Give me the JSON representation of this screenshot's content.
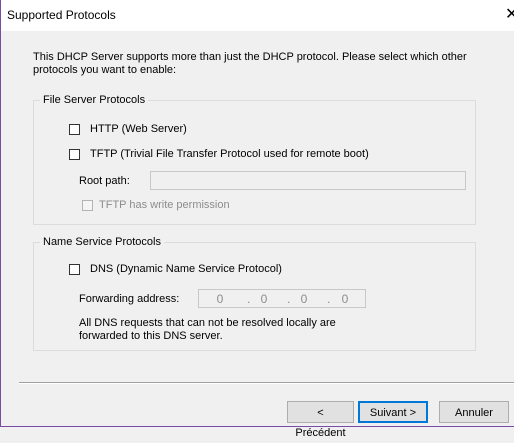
{
  "window": {
    "title": "Supported Protocols",
    "close_glyph": "✕"
  },
  "intro_text": "This DHCP Server supports more than just the DHCP protocol. Please select which other protocols you want to enable:",
  "file_server": {
    "group_label": "File Server Protocols",
    "http": {
      "label": "HTTP (Web Server)",
      "checked": false
    },
    "tftp": {
      "label": "TFTP (Trivial File Transfer Protocol used for remote boot)",
      "checked": false
    },
    "root_path_label": "Root path:",
    "root_path_value": "",
    "write_permission": {
      "label": "TFTP has write permission",
      "checked": false,
      "enabled": false
    }
  },
  "name_service": {
    "group_label": "Name Service Protocols",
    "dns": {
      "label": "DNS (Dynamic Name Service Protocol)",
      "checked": false
    },
    "forwarding_label": "Forwarding address:",
    "forwarding_octets": [
      "0",
      "0",
      "0",
      "0"
    ],
    "note": "All DNS requests that can not be resolved locally are forwarded to this DNS server."
  },
  "buttons": {
    "back": "< Précédent",
    "next": "Suivant >",
    "cancel": "Annuler"
  },
  "colors": {
    "window_border": "#7b4aa9",
    "default_button_border": "#0078d7"
  }
}
